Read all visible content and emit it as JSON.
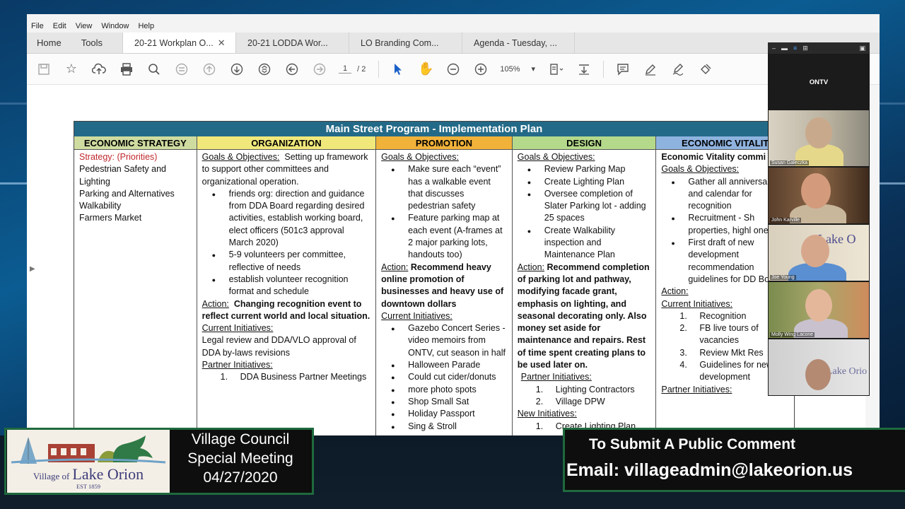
{
  "menu": [
    "File",
    "Edit",
    "View",
    "Window",
    "Help"
  ],
  "nav_tabs": {
    "home": "Home",
    "tools": "Tools"
  },
  "doc_tabs": [
    {
      "label": "20-21 Workplan O...",
      "active": true
    },
    {
      "label": "20-21 LODDA Wor...",
      "active": false
    },
    {
      "label": "LO Branding Com...",
      "active": false
    },
    {
      "label": "Agenda - Tuesday, ...",
      "active": false
    }
  ],
  "toolbar": {
    "page_current": "1",
    "page_total": "/  2",
    "zoom": "105%"
  },
  "plan": {
    "title": "Main Street Program - Implementation Plan",
    "headers": {
      "economic_strategy": "ECONOMIC STRATEGY",
      "organization": "ORGANIZATION",
      "promotion": "PROMOTION",
      "design": "DESIGN",
      "economic_vitality": "ECONOMIC VITALIT"
    },
    "strategy": {
      "heading": "Strategy:  (Priorities)",
      "items": [
        "Pedestrian Safety and Lighting",
        "Parking and Alternatives",
        "Walkability",
        "Farmers Market"
      ]
    },
    "organization": {
      "goals_label": "Goals & Objectives:",
      "goals_text": "Setting up framework to support other committees and organizational operation.",
      "bullets": [
        "friends org: direction and guidance from DDA Board regarding desired activities, establish working board, elect officers (501c3 approval March 2020)",
        "5-9 volunteers  per committee, reflective of needs",
        "establish volunteer recognition format and schedule"
      ],
      "action_label": "Action:",
      "action_text": "Changing recognition event to reflect current world  and local situation.",
      "current_label": "Current Initiatives:",
      "current_text": "Legal review and DDA/VLO approval of DDA by-laws revisions",
      "partner_label": "Partner Initiatives:",
      "partner_items": [
        "DDA Business Partner Meetings"
      ]
    },
    "promotion": {
      "goals_label": "Goals & Objectives:",
      "bullets": [
        "Make sure each “event” has a walkable event that discusses pedestrian safety",
        "Feature parking map at each event (A-frames at 2  major parking lots, handouts too)"
      ],
      "action_label": "Action:",
      "action_text": "Recommend heavy online promotion of businesses and heavy use of downtown dollars",
      "current_label": "Current Initiatives:",
      "current_items": [
        "Gazebo Concert Series - video memoirs from ONTV, cut season in half",
        "Halloween Parade",
        "Could cut cider/donuts",
        "more photo spots",
        "Shop Small Sat",
        "Holiday Passport",
        "Sing & Stroll"
      ]
    },
    "design": {
      "goals_label": "Goals & Objectives:",
      "bullets": [
        "Review Parking Map",
        "Create Lighting Plan",
        "Oversee completion of Slater Parking lot - adding 25 spaces",
        "Create Walkability inspection and Maintenance Plan"
      ],
      "action_label": "Action:",
      "action_text": "Recommend completion of parking lot and pathway, modifying facade grant, emphasis on lighting, and seasonal decorating only. Also money set aside for maintenance and repairs. Rest of time spent creating plans to be used later on.",
      "partner_label": "Partner Initiatives:",
      "partner_items": [
        "Lighting Contractors",
        "Village DPW"
      ],
      "new_label": "New Initiatives:",
      "new_items": [
        "Create Lighting Plan"
      ]
    },
    "vitality": {
      "intro": "Economic Vitality commi",
      "goals_label": "Goals & Objectives:",
      "bullets": [
        "Gather all anniversaries and calendar for recognition",
        "Recruitment - Sh properties, highl one,",
        "First draft of new development recommendation guidelines for DD Board."
      ],
      "action_label": "Action:",
      "current_label": "Current Initiatives:",
      "current_items": [
        "Recognition",
        "FB live tours of vacancies",
        "Review Mkt Res",
        "Guidelines for new development"
      ],
      "partner_label": "Partner Initiatives:"
    }
  },
  "video": {
    "host_label": "ONTV",
    "participants": [
      {
        "name": "Susan Galeczka"
      },
      {
        "name": "John Karville"
      },
      {
        "name": "Joe Young"
      },
      {
        "name": "Molly Wing Lacone"
      },
      {
        "name": ""
      }
    ]
  },
  "logo": {
    "line_small": "Village of",
    "line_big": "Lake Orion",
    "est": "EST 1859"
  },
  "meeting": {
    "line1": "Village Council",
    "line2": "Special Meeting",
    "date": "04/27/2020"
  },
  "comment": {
    "line1": "To Submit A Public Comment",
    "line2": "Email: villageadmin@lakeorion.us"
  },
  "colors": {
    "title_bar": "#236a88",
    "strategy_head": "#cfdca0",
    "organization_head": "#f1e87c",
    "promotion_head": "#f1b23a",
    "design_head": "#b4d98b",
    "vitality_head": "#8fb3df",
    "accent_green": "#1f6a3e"
  }
}
